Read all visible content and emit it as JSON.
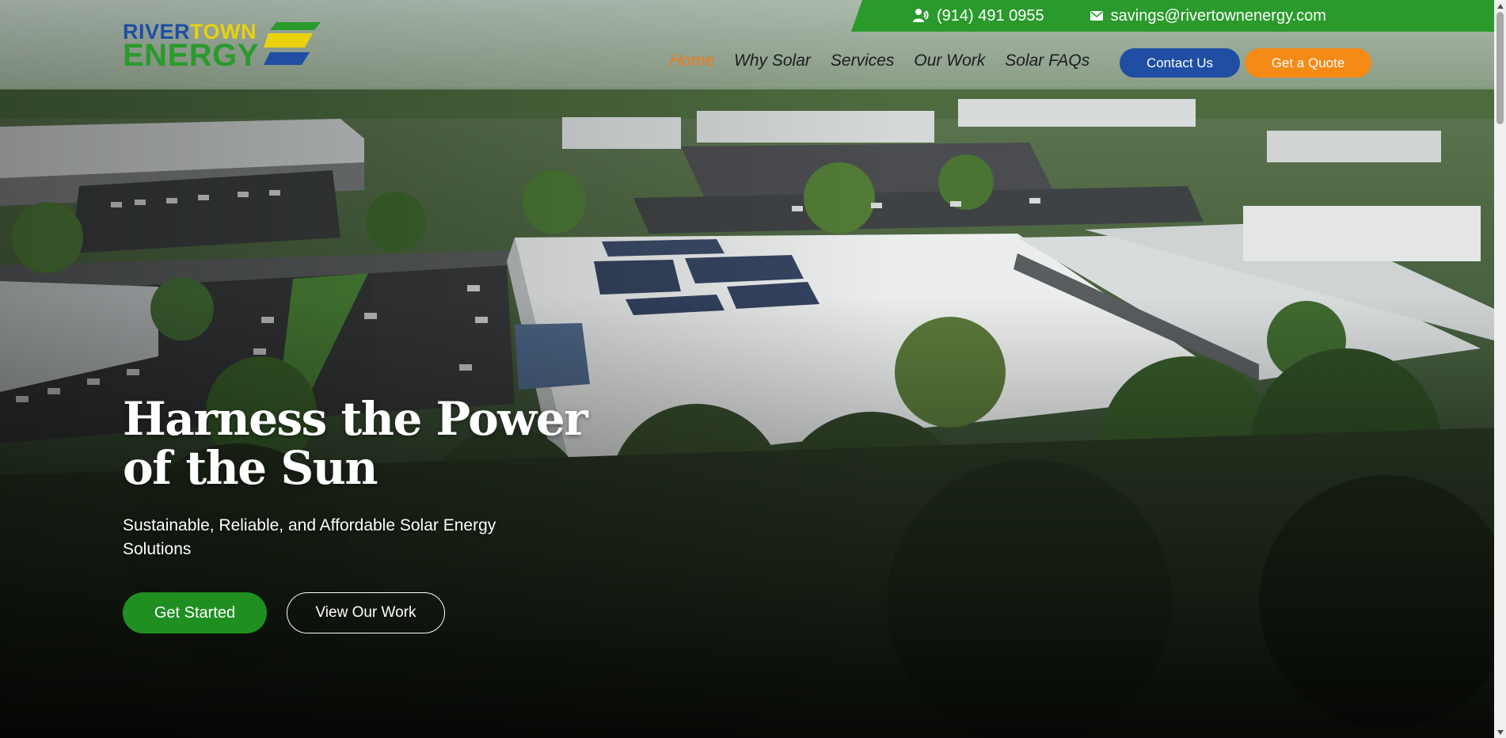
{
  "topbar": {
    "phone": "(914) 491 0955",
    "email": "savings@rivertownenergy.com",
    "phone_icon": "phone-user-icon",
    "email_icon": "envelope-icon",
    "bg_color": "#2a9a2c"
  },
  "logo": {
    "word1a": "RIVER",
    "word1b": "TOWN",
    "word2": "ENERGY",
    "colors": {
      "blue": "#1f4ea3",
      "yellow": "#e9d20c",
      "green": "#2a9a2c"
    }
  },
  "nav": {
    "items": [
      {
        "label": "Home",
        "active": true
      },
      {
        "label": "Why Solar",
        "active": false
      },
      {
        "label": "Services",
        "active": false
      },
      {
        "label": "Our Work",
        "active": false
      },
      {
        "label": "Solar FAQs",
        "active": false
      }
    ],
    "active_color": "#f07a12"
  },
  "header_buttons": {
    "contact": "Contact Us",
    "quote": "Get a Quote",
    "contact_color": "#1f4ea3",
    "quote_color": "#f58a17"
  },
  "hero": {
    "title_line1": "Harness the Power",
    "title_line2": "of the Sun",
    "subtitle": "Sustainable, Reliable, and Affordable Solar Energy Solutions",
    "cta_primary": "Get Started",
    "cta_secondary": "View Our Work",
    "cta_primary_color": "#1f8f22"
  }
}
